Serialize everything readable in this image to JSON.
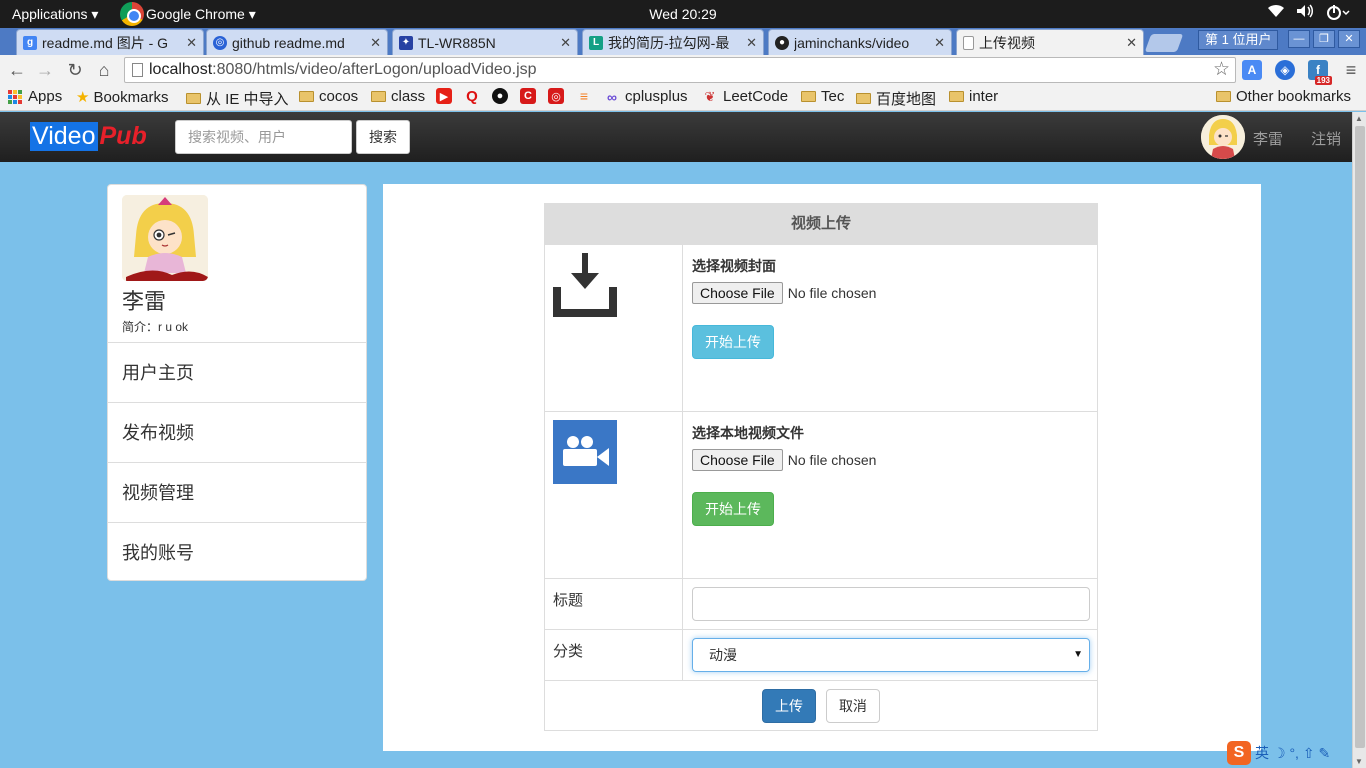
{
  "os": {
    "applications": "Applications ▾",
    "browser_menu": "Google Chrome ▾",
    "clock": "Wed 20:29"
  },
  "tabs": [
    {
      "label": "readme.md 图片 - G",
      "favicon": "google-icon"
    },
    {
      "label": "github readme.md",
      "favicon": "baidu-icon"
    },
    {
      "label": "TL-WR885N",
      "favicon": "tplink-icon"
    },
    {
      "label": "我的简历-拉勾网-最",
      "favicon": "lagou-icon"
    },
    {
      "label": "jaminchanks/video",
      "favicon": "github-icon"
    },
    {
      "label": "上传视频",
      "favicon": "page-icon"
    }
  ],
  "browser_user": "第 1 位用户",
  "address": {
    "host": "localhost",
    "path": ":8080/htmls/video/afterLogon/uploadVideo.jsp"
  },
  "bookmarks": {
    "apps": "Apps",
    "items": [
      "Bookmarks",
      "从 IE 中导入",
      "cocos",
      "class",
      "cplusplus",
      "LeetCode",
      "Tec",
      "百度地图",
      "inter"
    ],
    "other": "Other bookmarks",
    "ext_badge": "193"
  },
  "site": {
    "brand_part1": "Video",
    "brand_part2": "Pub",
    "search_placeholder": "搜索视频、用户",
    "search_button": "搜索",
    "username": "李雷",
    "logout": "注销"
  },
  "sidebar": {
    "name": "李雷",
    "bio": "简介：r u ok",
    "menu": [
      "用户主页",
      "发布视频",
      "视频管理",
      "我的账号"
    ]
  },
  "upload": {
    "heading": "视频上传",
    "cover_label": "选择视频封面",
    "video_label": "选择本地视频文件",
    "choose_file": "Choose File",
    "no_file": "No file chosen",
    "start_upload": "开始上传",
    "title_label": "标题",
    "category_label": "分类",
    "category_value": "动漫",
    "submit": "上传",
    "cancel": "取消"
  },
  "ime": {
    "lang": "英",
    "extra": "☽ °, ⇧ ✎"
  },
  "colors": {
    "page_bg": "#7bc0ea",
    "brand_blue": "#1473e6",
    "brand_red": "#e8202a",
    "btn_info": "#5bc0de",
    "btn_success": "#5cb85c",
    "btn_primary": "#337ab7"
  }
}
